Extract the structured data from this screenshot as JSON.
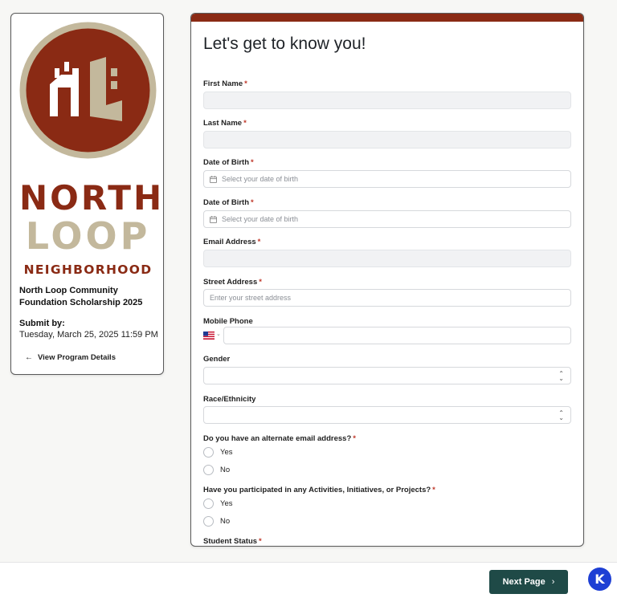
{
  "program": {
    "logo": {
      "line1": "NORTH",
      "line2": "LOOP",
      "line3": "NEIGHBORHOOD"
    },
    "title": "North Loop Community Foundation Scholarship 2025",
    "submit_label": "Submit by:",
    "submit_date": "Tuesday, March 25, 2025 11:59 PM",
    "view_details": "View Program Details"
  },
  "form": {
    "title": "Let's get to know you!",
    "required_mark": "*",
    "fields": {
      "first_name": {
        "label": "First Name",
        "value": ""
      },
      "last_name": {
        "label": "Last Name",
        "value": ""
      },
      "dob1": {
        "label": "Date of Birth",
        "placeholder": "Select your date of birth"
      },
      "dob2": {
        "label": "Date of Birth",
        "placeholder": "Select your date of birth"
      },
      "email": {
        "label": "Email Address",
        "value": ""
      },
      "street": {
        "label": "Street Address",
        "placeholder": "Enter your street address"
      },
      "phone": {
        "label": "Mobile Phone",
        "value": ""
      },
      "gender": {
        "label": "Gender",
        "value": ""
      },
      "race": {
        "label": "Race/Ethnicity",
        "value": ""
      }
    },
    "questions": {
      "alt_email": {
        "text": "Do you have an alternate email address?",
        "options": [
          "Yes",
          "No"
        ]
      },
      "participated": {
        "text": "Have you participated in any Activities, Initiatives, or Projects?",
        "options": [
          "Yes",
          "No"
        ]
      },
      "student_status": {
        "text": "Student Status"
      }
    }
  },
  "footer": {
    "next_label": "Next Page",
    "help_letter": "K"
  },
  "colors": {
    "brand_red": "#8a2a14",
    "brand_tan": "#c3b89c",
    "button_teal": "#1f4a47",
    "help_blue": "#1e3fd4"
  }
}
